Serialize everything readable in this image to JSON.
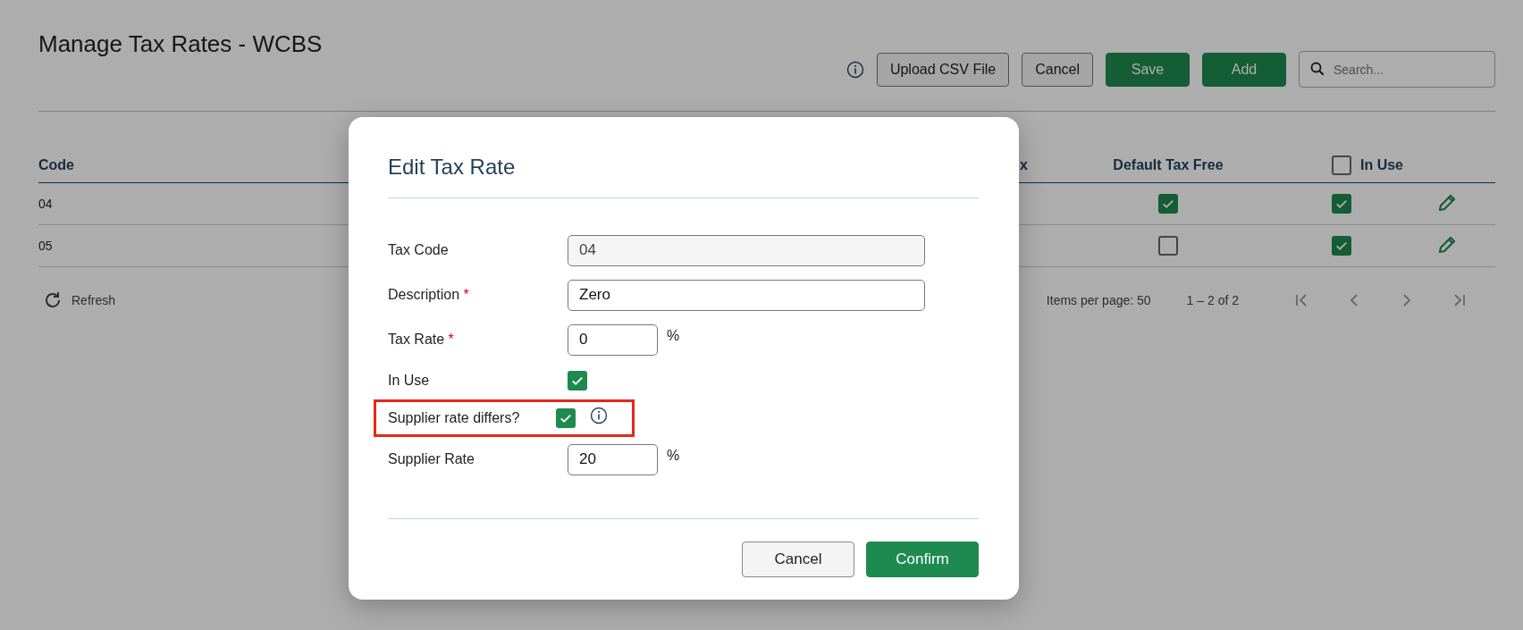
{
  "page": {
    "title": "Manage Tax Rates - WCBS"
  },
  "toolbar": {
    "buttons": [
      {
        "label": "Upload CSV File",
        "kind": "outline"
      },
      {
        "label": "Cancel",
        "kind": "outline"
      },
      {
        "label": "Save",
        "kind": "primary"
      },
      {
        "label": "Add",
        "kind": "primary"
      }
    ],
    "search": {
      "placeholder": "Search..."
    }
  },
  "table": {
    "columns": [
      {
        "label": "Code"
      },
      {
        "label": "x"
      },
      {
        "label": "Default Tax Free"
      },
      {
        "label": "In Use",
        "checked": false
      }
    ],
    "rows": [
      {
        "code": "04",
        "default_tax_free": true,
        "in_use": true
      },
      {
        "code": "05",
        "default_tax_free": false,
        "in_use": true
      }
    ]
  },
  "refresh": "Refresh",
  "paginator": {
    "items_per_page_label": "Items per page:",
    "items_per_page": "50",
    "range": "1 – 2 of 2"
  },
  "dialog": {
    "title": "Edit Tax Rate",
    "fields": [
      {
        "label": "Tax Code",
        "kind": "text",
        "value": "04",
        "disabled": true,
        "info": false,
        "highlighted": false
      },
      {
        "label": "Description",
        "required_mark": "*",
        "kind": "text",
        "value": "Zero",
        "disabled": false,
        "info": false,
        "highlighted": false
      },
      {
        "label": "Tax Rate",
        "required_mark": "*",
        "kind": "text",
        "value": "0",
        "unit": "%",
        "disabled": false,
        "info": false,
        "highlighted": false
      },
      {
        "label": "In Use",
        "kind": "checkbox",
        "checked": true,
        "info": false,
        "highlighted": false
      },
      {
        "label": "Supplier rate differs?",
        "kind": "checkbox",
        "checked": true,
        "info": true,
        "highlighted": true
      },
      {
        "label": "Supplier Rate",
        "kind": "text",
        "value": "20",
        "unit": "%",
        "disabled": false,
        "info": false,
        "highlighted": false
      }
    ],
    "buttons": [
      {
        "label": "Cancel",
        "kind": "outline"
      },
      {
        "label": "Confirm",
        "kind": "primary"
      }
    ]
  }
}
